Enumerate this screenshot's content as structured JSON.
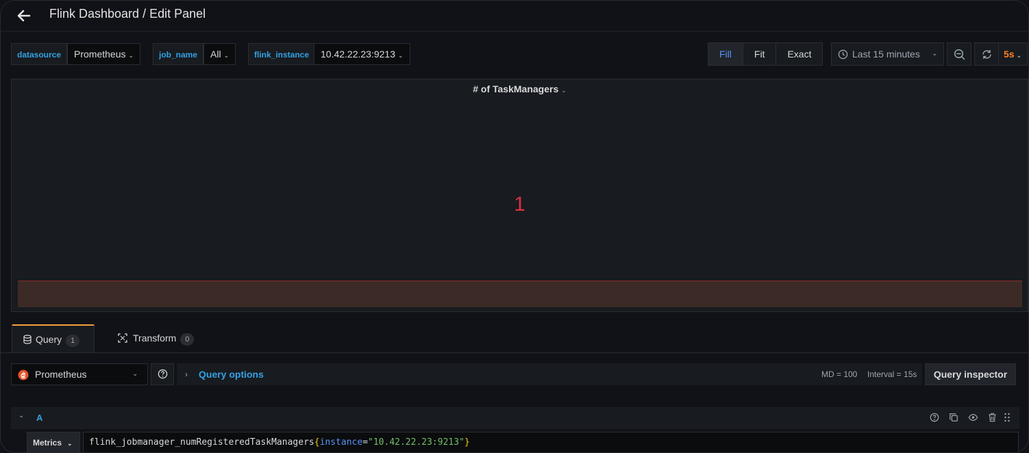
{
  "header": {
    "title": "Flink Dashboard / Edit Panel"
  },
  "variables": [
    {
      "label": "datasource",
      "value": "Prometheus"
    },
    {
      "label": "job_name",
      "value": "All"
    },
    {
      "label": "flink_instance",
      "value": "10.42.22.23:9213"
    }
  ],
  "view_modes": {
    "fill": "Fill",
    "fit": "Fit",
    "exact": "Exact",
    "active": "Fill"
  },
  "time_range": {
    "label": "Last 15 minutes",
    "refresh": "5s"
  },
  "panel": {
    "title": "# of TaskManagers",
    "value": "1",
    "value_color": "#e02f44"
  },
  "tabs": [
    {
      "label": "Query",
      "count": "1"
    },
    {
      "label": "Transform",
      "count": "0"
    }
  ],
  "query_editor": {
    "datasource": "Prometheus",
    "options_label": "Query options",
    "md": "MD = 100",
    "interval": "Interval = 15s",
    "inspector": "Query inspector"
  },
  "query_a": {
    "ref": "A",
    "mode": "Metrics",
    "metric": "flink_jobmanager_numRegisteredTaskManagers",
    "label_key": "instance",
    "label_value": "\"10.42.22.23:9213\""
  },
  "colors": {
    "accent": "#33a2e5",
    "active_tab": "#f79f3c",
    "threshold_red": "#e02f44"
  }
}
